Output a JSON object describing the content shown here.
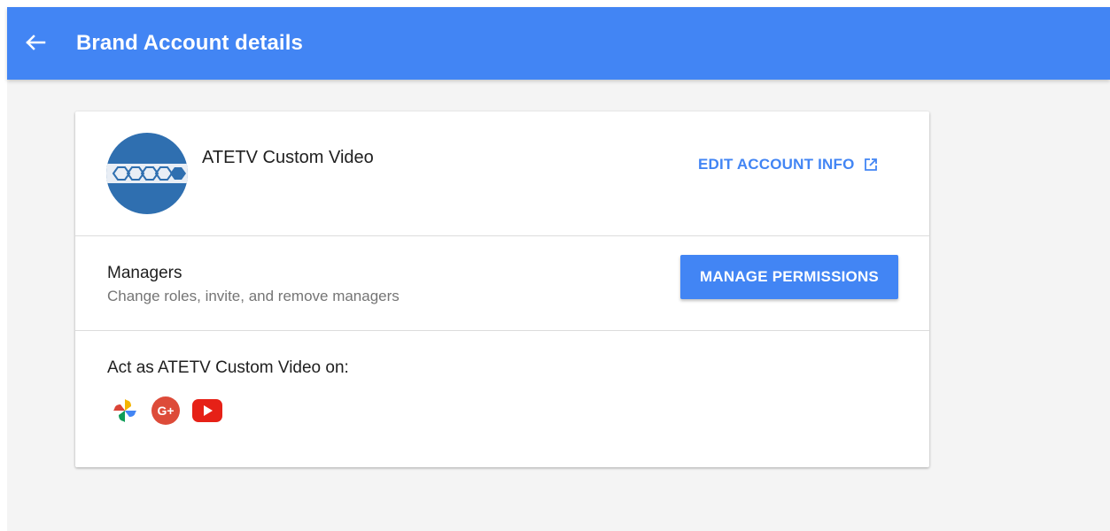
{
  "header": {
    "title": "Brand Account details",
    "back_icon": "arrow-left-icon",
    "color": "#4285f4"
  },
  "account": {
    "name": "ATETV Custom Video",
    "avatar_icon": "atetv-logo-avatar",
    "avatar_text": "ATETV",
    "edit_label": "EDIT ACCOUNT INFO",
    "edit_icon": "open-in-new-icon"
  },
  "managers": {
    "title": "Managers",
    "subtitle": "Change roles, invite, and remove managers",
    "button_label": "MANAGE PERMISSIONS"
  },
  "act_as": {
    "title": "Act as ATETV Custom Video on:",
    "services": [
      {
        "icon": "google-photos-icon"
      },
      {
        "icon": "google-plus-icon",
        "label": "G+"
      },
      {
        "icon": "youtube-icon"
      }
    ]
  },
  "colors": {
    "accent": "#4285f4",
    "background": "#f4f4f4",
    "google_plus": "#dd4b39",
    "youtube": "#e62117"
  }
}
